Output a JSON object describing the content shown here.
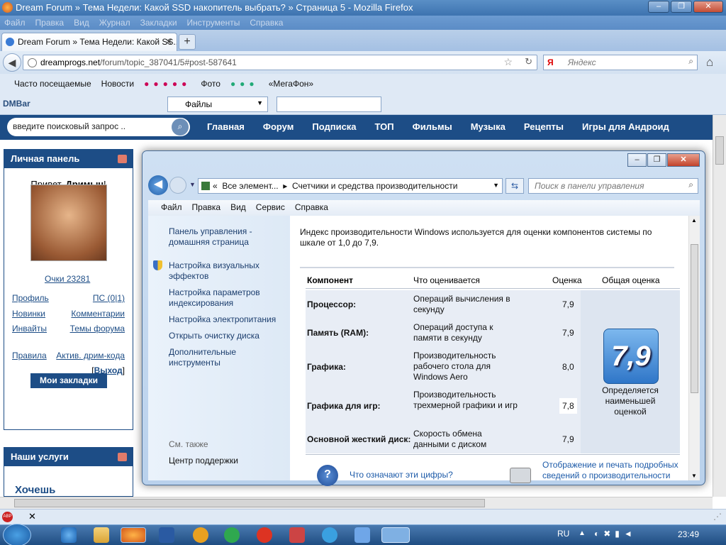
{
  "browser": {
    "title": "Dream Forum » Тема Недели: Какой SSD накопитель выбрать? » Страница 5 - Mozilla Firefox",
    "menu": [
      "Файл",
      "Правка",
      "Вид",
      "Журнал",
      "Закладки",
      "Инструменты",
      "Справка"
    ],
    "tab_title": "Dream Forum » Тема Недели: Какой SS...",
    "url_host": "dreamprogs.net",
    "url_path": "/forum/topic_387041/5#post-587641",
    "search_placeholder": "Яндекс",
    "bookmarks": [
      "Часто посещаемые",
      "Новости",
      "Фото",
      "«МегаФон»"
    ],
    "dmbar_label": "DMBar",
    "files_label": "Файлы"
  },
  "site": {
    "search_placeholder": "введите поисковый запрос ..",
    "nav": [
      "Главная",
      "Форум",
      "Подписка",
      "ТОП",
      "Фильмы",
      "Музыка",
      "Рецепты",
      "Игры для Андроид"
    ],
    "panel_title": "Личная панель",
    "greeting": "Привет,",
    "username": "Дримыч",
    "points": "Очки 23281",
    "links_left": [
      "Профиль",
      "Новинки",
      "Инвайты",
      "Правила"
    ],
    "links_right": [
      "ПС (0|1)",
      "Комментарии",
      "Темы форума",
      "Актив. дрим-кода"
    ],
    "logout": "Выход",
    "bookmarks_btn": "Мои закладки",
    "services_title": "Наши услуги",
    "services_text": "Хочешь"
  },
  "dialog": {
    "breadcrumb_1": "Все элемент...",
    "breadcrumb_2": "Счетчики и средства производительности",
    "search_placeholder": "Поиск в панели управления",
    "menu": [
      "Файл",
      "Правка",
      "Вид",
      "Сервис",
      "Справка"
    ],
    "left_links": [
      "Панель управления - домашняя страница",
      "Настройка визуальных эффектов",
      "Настройка параметров индексирования",
      "Настройка электропитания",
      "Открыть очистку диска",
      "Дополнительные инструменты"
    ],
    "see_also": "См. также",
    "support": "Центр поддержки",
    "intro": "Индекс производительности Windows используется для оценки компонентов системы по шкале от 1,0 до 7,9.",
    "headers": [
      "Компонент",
      "Что оценивается",
      "Оценка",
      "Общая оценка"
    ],
    "rows": [
      {
        "component": "Процессор:",
        "what": "Операций вычисления в секунду",
        "score": "7,9"
      },
      {
        "component": "Память (RAM):",
        "what": "Операций доступа к памяти в секунду",
        "score": "7,9"
      },
      {
        "component": "Графика:",
        "what": "Производительность рабочего стола для Windows Aero",
        "score": "8,0"
      },
      {
        "component": "Графика для игр:",
        "what": "Производительность трехмерной графики и игр",
        "score": "7,8"
      },
      {
        "component": "Основной жесткий диск:",
        "what": "Скорость обмена данными с диском",
        "score": "7,9"
      }
    ],
    "base_score": "7,9",
    "base_note": "Определяется наименьшей оценкой",
    "help_link": "Что означают эти цифры?",
    "print_link": "Отображение и печать подробных сведений о производительности"
  },
  "taskbar": {
    "lang": "RU",
    "time": "23:49"
  }
}
